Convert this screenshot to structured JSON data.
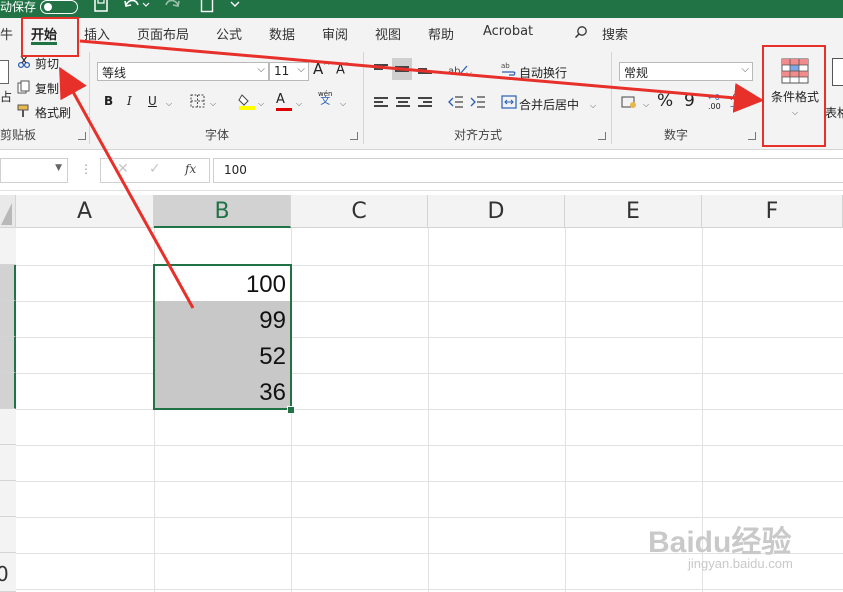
{
  "title_bar": {
    "autosave_label": "动保存",
    "qat_icons": [
      "save-icon",
      "undo-icon",
      "redo-icon",
      "new-file-icon",
      "customize-qat-icon"
    ]
  },
  "tabs": {
    "file_partial": "牛",
    "items": [
      "开始",
      "插入",
      "页面布局",
      "公式",
      "数据",
      "审阅",
      "视图",
      "帮助",
      "Acrobat"
    ],
    "active": "开始",
    "search_label": "搜索"
  },
  "ribbon": {
    "clipboard": {
      "paste_partial": "占",
      "cut": "剪切",
      "copy": "复制",
      "format_painter": "格式刷",
      "group_label": "剪贴板"
    },
    "font": {
      "font_name": "等线",
      "font_size": "11",
      "grow_font": "A",
      "shrink_font": "A",
      "bold": "B",
      "italic": "I",
      "underline": "U",
      "font_color_letter": "A",
      "highlight_color": "#ffff00",
      "font_color": "#e00000",
      "phonetic_top": "wén",
      "phonetic_bottom": "文",
      "group_label": "字体"
    },
    "alignment": {
      "wrap_text": "自动换行",
      "merge_center": "合并后居中",
      "group_label": "对齐方式"
    },
    "number": {
      "format": "常规",
      "percent": "%",
      "comma": "9",
      "inc_decimal": ".00",
      "dec_decimal": "→0",
      "group_label": "数字"
    },
    "styles": {
      "conditional_formatting": "条件格式",
      "format_as_table_partial": "表格"
    }
  },
  "formula_bar": {
    "name_box": "",
    "fx": "fx",
    "value": "100"
  },
  "sheet": {
    "columns": [
      "A",
      "B",
      "C",
      "D",
      "E",
      "F"
    ],
    "selected_column": "B",
    "b_values": [
      "100",
      "99",
      "52",
      "36"
    ],
    "row_label_partial": "0"
  },
  "annotation_color": "#e8302a",
  "accent_color": "#217346",
  "watermark": {
    "brand": "Baidu经验",
    "url": "jingyan.baidu.com"
  }
}
